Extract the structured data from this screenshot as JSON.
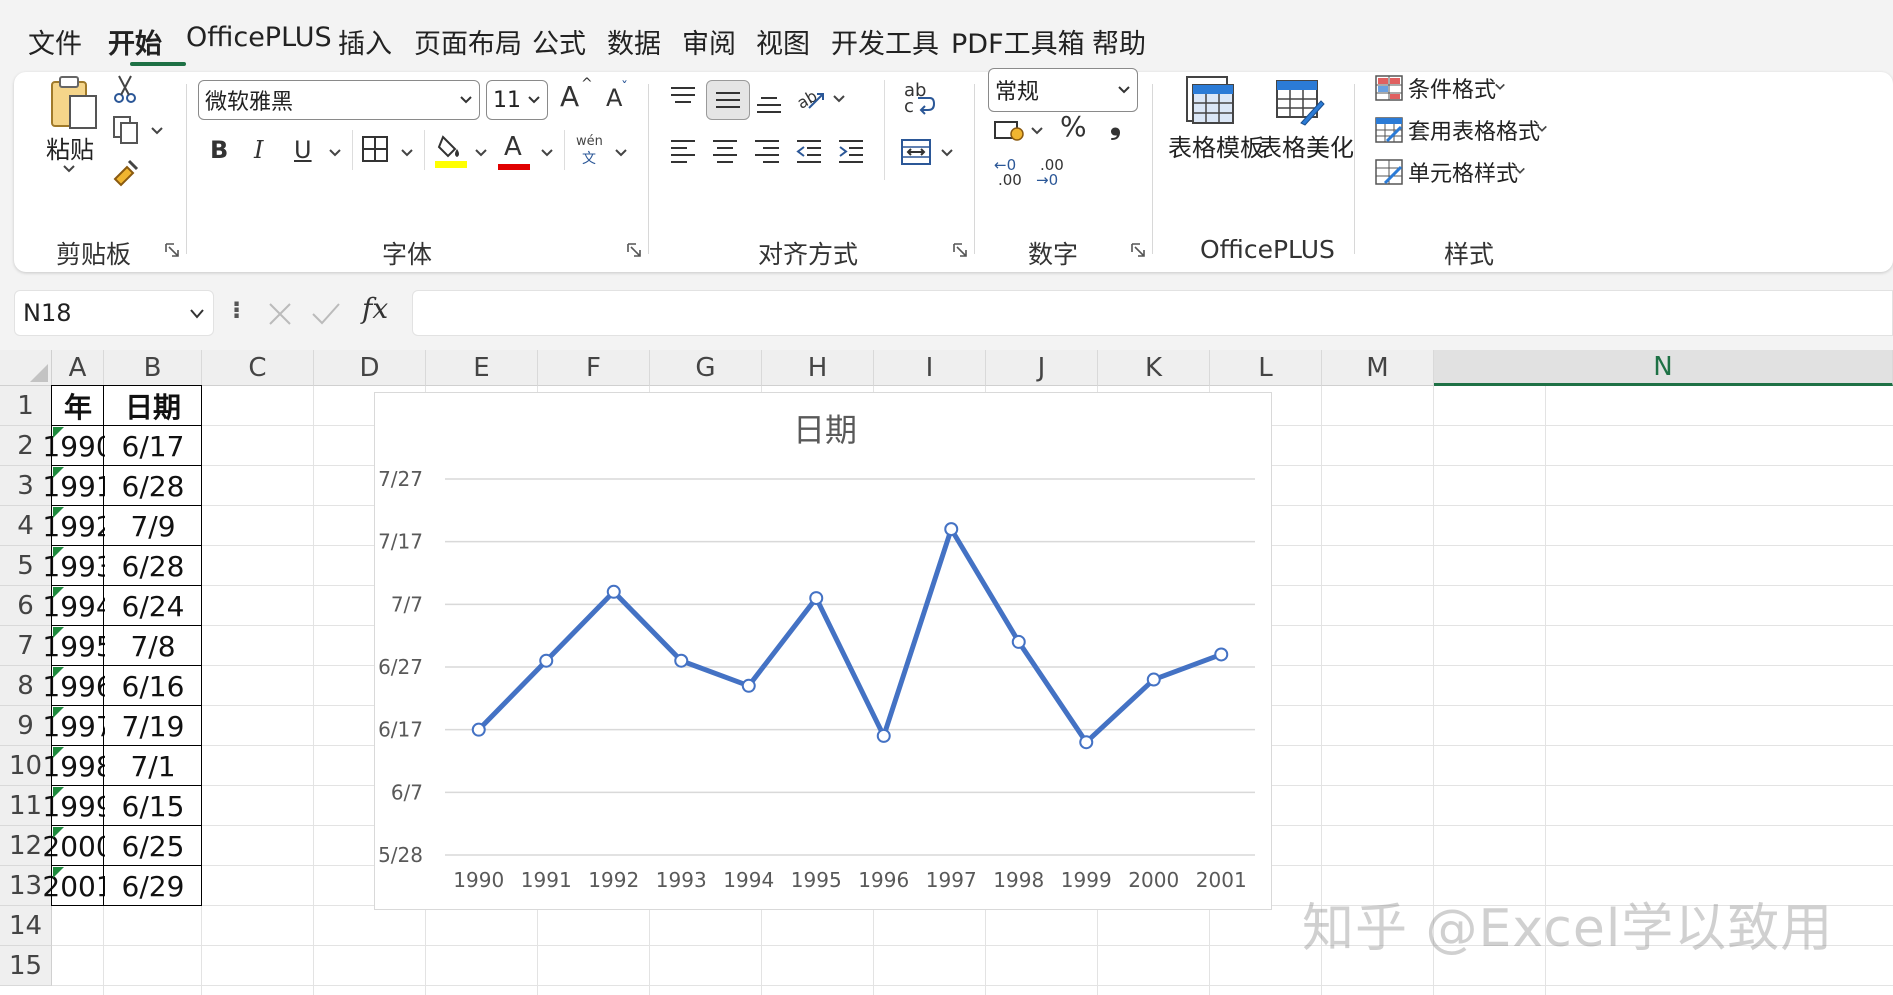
{
  "menu": {
    "tabs": [
      {
        "label": "文件",
        "active": false
      },
      {
        "label": "开始",
        "active": true
      },
      {
        "label": "OfficePLUS",
        "active": false
      },
      {
        "label": "插入",
        "active": false
      },
      {
        "label": "页面布局",
        "active": false
      },
      {
        "label": "公式",
        "active": false
      },
      {
        "label": "数据",
        "active": false
      },
      {
        "label": "审阅",
        "active": false
      },
      {
        "label": "视图",
        "active": false
      },
      {
        "label": "开发工具",
        "active": false
      },
      {
        "label": "PDF工具箱",
        "active": false
      },
      {
        "label": "帮助",
        "active": false
      }
    ],
    "accent_color": "#1e7145"
  },
  "ribbon": {
    "clipboard": {
      "group_label": "剪贴板",
      "paste_label": "粘贴"
    },
    "font": {
      "group_label": "字体",
      "font_name": "微软雅黑",
      "font_size": "11",
      "grow_label": "A",
      "shrink_label": "A",
      "bold_label": "B",
      "italic_label": "I",
      "underline_label": "U",
      "font_color_label": "A",
      "phonetic_top": "wén",
      "phonetic_bottom": "文",
      "highlight_color": "#ffff00",
      "font_color": "#e00000"
    },
    "alignment": {
      "group_label": "对齐方式",
      "wrap_top": "ab",
      "wrap_bottom": "c"
    },
    "number": {
      "group_label": "数字",
      "format": "常规",
      "percent_label": "%",
      "comma_label": "❟",
      "inc_decimal_top": "←0",
      "inc_decimal_bottom": ".00",
      "dec_decimal_top": ".00",
      "dec_decimal_bottom": "→0"
    },
    "officeplus": {
      "group_label": "OfficePLUS",
      "table_template": "表格模板",
      "table_beautify": "表格美化"
    },
    "styles": {
      "group_label": "样式",
      "conditional": "条件格式",
      "format_as_table": "套用表格格式",
      "cell_styles": "单元格样式"
    }
  },
  "formula_bar": {
    "name_box": "N18",
    "fx_label": "fx",
    "formula": ""
  },
  "sheet": {
    "columns": [
      "A",
      "B",
      "C",
      "D",
      "E",
      "F",
      "G",
      "H",
      "I",
      "J",
      "K",
      "L",
      "M",
      "N"
    ],
    "selected_column": "N",
    "rows": [
      "1",
      "2",
      "3",
      "4",
      "5",
      "6",
      "7",
      "8",
      "9",
      "10",
      "11",
      "12",
      "13",
      "14",
      "15"
    ],
    "table": {
      "headers": [
        "年",
        "日期"
      ],
      "rows": [
        [
          "1990",
          "6/17"
        ],
        [
          "1991",
          "6/28"
        ],
        [
          "1992",
          "7/9"
        ],
        [
          "1993",
          "6/28"
        ],
        [
          "1994",
          "6/24"
        ],
        [
          "1995",
          "7/8"
        ],
        [
          "1996",
          "6/16"
        ],
        [
          "1997",
          "7/19"
        ],
        [
          "1998",
          "7/1"
        ],
        [
          "1999",
          "6/15"
        ],
        [
          "2000",
          "6/25"
        ],
        [
          "2001",
          "6/29"
        ]
      ]
    }
  },
  "chart_data": {
    "type": "line",
    "title": "日期",
    "categories": [
      "1990",
      "1991",
      "1992",
      "1993",
      "1994",
      "1995",
      "1996",
      "1997",
      "1998",
      "1999",
      "2000",
      "2001"
    ],
    "series": [
      {
        "values": [
          "6/17",
          "6/28",
          "7/9",
          "6/28",
          "6/24",
          "7/8",
          "6/16",
          "7/19",
          "7/1",
          "6/15",
          "6/25",
          "6/29"
        ],
        "color": "#4472c4"
      }
    ],
    "y_ticks": [
      "5/28",
      "6/7",
      "6/17",
      "6/27",
      "7/7",
      "7/17",
      "7/27"
    ],
    "ylim": [
      "5/28",
      "7/27"
    ],
    "grid": true,
    "legend": "none"
  },
  "watermark": "知乎 @Excel学以致用"
}
